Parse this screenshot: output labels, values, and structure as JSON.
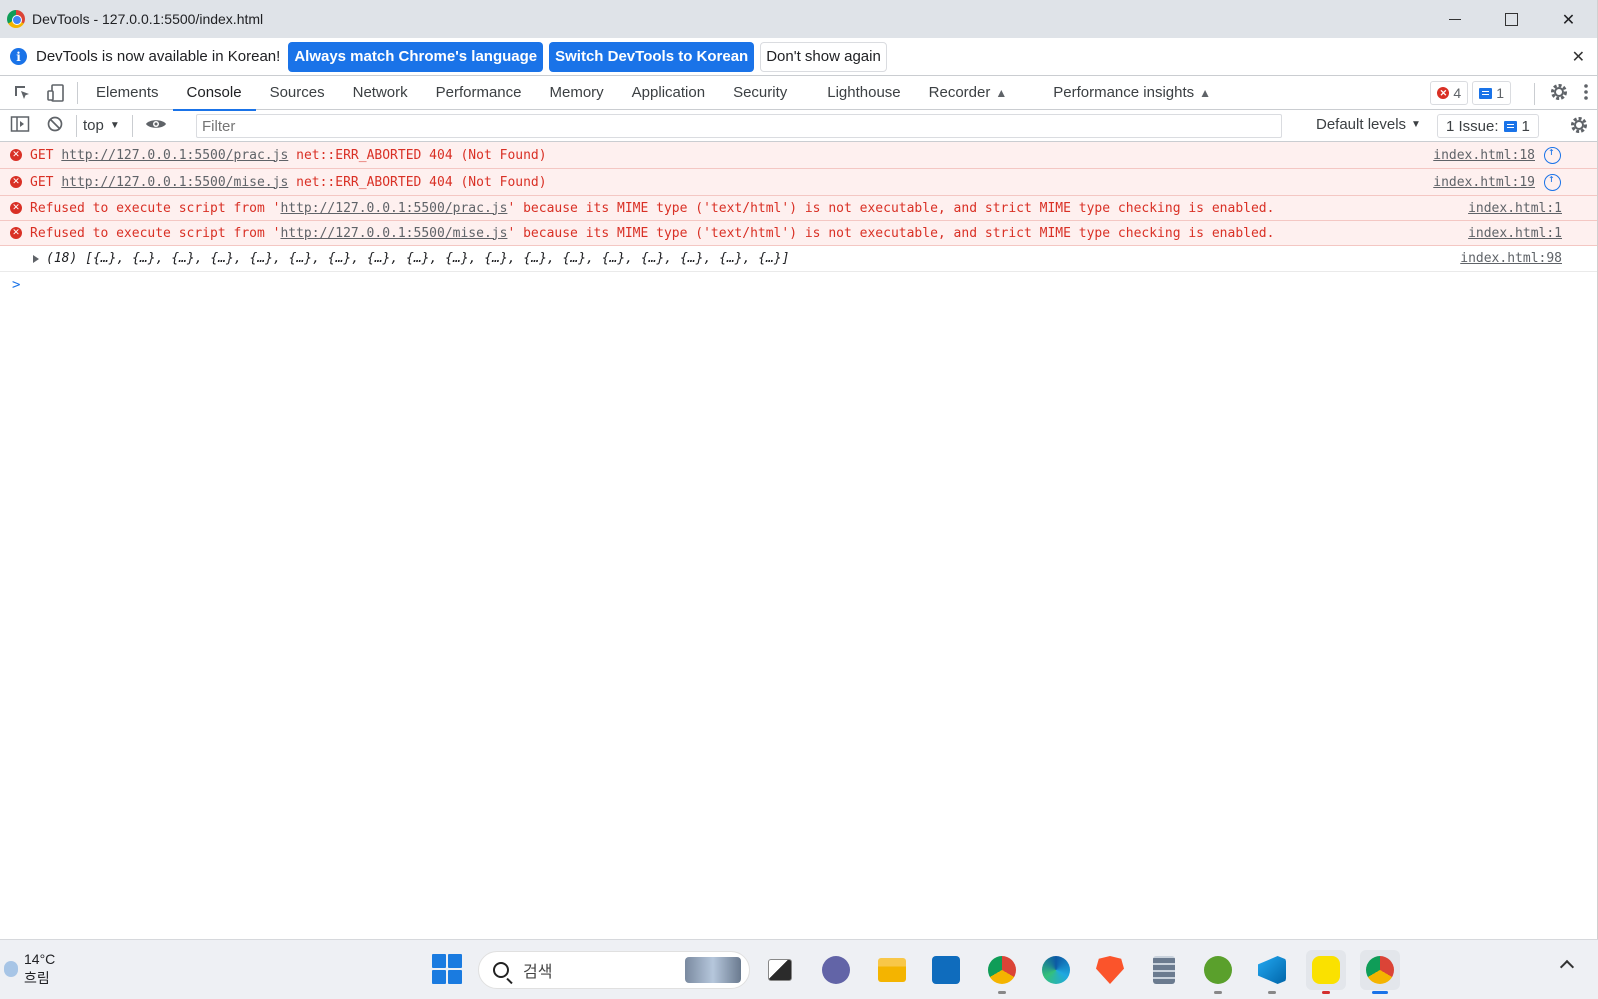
{
  "window": {
    "title": "DevTools - 127.0.0.1:5500/index.html"
  },
  "infobar": {
    "message": "DevTools is now available in Korean!",
    "btn_match": "Always match Chrome's language",
    "btn_switch": "Switch DevTools to Korean",
    "btn_dismiss": "Don't show again"
  },
  "tabs": {
    "elements": "Elements",
    "console": "Console",
    "sources": "Sources",
    "network": "Network",
    "performance": "Performance",
    "memory": "Memory",
    "application": "Application",
    "security": "Security",
    "lighthouse": "Lighthouse",
    "recorder": "Recorder",
    "perf_insights": "Performance insights"
  },
  "badges": {
    "errors": "4",
    "messages": "1"
  },
  "console_toolbar": {
    "context": "top",
    "filter_placeholder": "Filter",
    "levels": "Default levels",
    "issues_label": "1 Issue:",
    "issues_count": "1"
  },
  "messages": [
    {
      "pre": "GET ",
      "url": "http://127.0.0.1:5500/prac.js",
      "post": " net::ERR_ABORTED 404 (Not Found)",
      "source": "index.html:18"
    },
    {
      "pre": "GET ",
      "url": "http://127.0.0.1:5500/mise.js",
      "post": " net::ERR_ABORTED 404 (Not Found)",
      "source": "index.html:19"
    },
    {
      "pre": "Refused to execute script from '",
      "url": "http://127.0.0.1:5500/prac.js",
      "post": "' because its MIME type ('text/html') is not executable, and strict MIME type checking is enabled.",
      "source": "index.html:1"
    },
    {
      "pre": "Refused to execute script from '",
      "url": "http://127.0.0.1:5500/mise.js",
      "post": "' because its MIME type ('text/html') is not executable, and strict MIME type checking is enabled.",
      "source": "index.html:1"
    }
  ],
  "log": {
    "text": "(18) [{…}, {…}, {…}, {…}, {…}, {…}, {…}, {…}, {…}, {…}, {…}, {…}, {…}, {…}, {…}, {…}, {…}, {…}]",
    "source": "index.html:98"
  },
  "prompt": ">",
  "taskbar": {
    "temperature": "14°C",
    "condition": "흐림",
    "search_placeholder": "검색"
  },
  "colors": {
    "accent": "#1a73e8",
    "error": "#d93025",
    "error_bg": "#fef0ef"
  },
  "icons": [
    "inspect-icon",
    "device-toggle-icon",
    "flask-icon",
    "gear-icon",
    "more-icon",
    "sidebar-icon",
    "clear-icon",
    "eye-icon",
    "network-request-icon"
  ]
}
